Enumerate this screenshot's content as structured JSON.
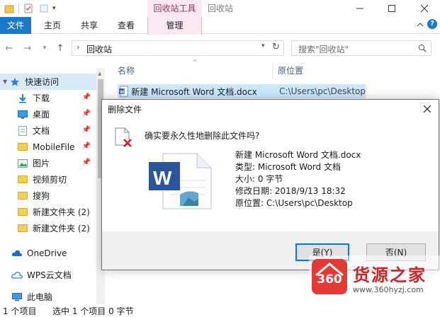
{
  "window": {
    "context_tab": "回收站工具",
    "title": "回收站"
  },
  "ribbon": {
    "tabs": [
      {
        "label": "文件"
      },
      {
        "label": "主页"
      },
      {
        "label": "共享"
      },
      {
        "label": "查看"
      },
      {
        "label": "管理"
      }
    ]
  },
  "address": {
    "path": "回收站",
    "search_placeholder": "搜索\"回收站\""
  },
  "nav": {
    "items": [
      {
        "label": "快速访问",
        "icon": "star-icon"
      },
      {
        "label": "下载",
        "icon": "download-icon"
      },
      {
        "label": "桌面",
        "icon": "desktop-icon"
      },
      {
        "label": "文档",
        "icon": "document-icon"
      },
      {
        "label": "MobileFile",
        "icon": "folder-icon"
      },
      {
        "label": "图片",
        "icon": "picture-icon"
      },
      {
        "label": "视频剪切",
        "icon": "folder-icon"
      },
      {
        "label": "搜狗",
        "icon": "folder-icon"
      },
      {
        "label": "新建文件夹 (2)",
        "icon": "folder-icon"
      },
      {
        "label": "新建文件夹 (2)",
        "icon": "folder-icon"
      },
      {
        "label": "OneDrive",
        "icon": "cloud-icon"
      },
      {
        "label": "WPS云文档",
        "icon": "wps-cloud-icon"
      },
      {
        "label": "此电脑",
        "icon": "computer-icon"
      }
    ]
  },
  "list": {
    "columns": [
      "名称",
      "原位置"
    ],
    "rows": [
      {
        "name": "新建 Microsoft Word 文档.docx",
        "location": "C:\\Users\\pc\\Desktop"
      }
    ]
  },
  "status": {
    "count": "1 个项目",
    "selected": "选中 1 个项目  0 字节"
  },
  "dialog": {
    "title": "删除文件",
    "question": "确实要永久性地删除此文件吗?",
    "file_name": "新建 Microsoft Word 文档.docx",
    "type": "类型: Microsoft Word 文档",
    "size": "大小: 0 字节",
    "modified": "修改日期: 2018/9/13 18:32",
    "origin": "原位置: C:\\Users\\pc\\Desktop",
    "yes_label": "是(Y)",
    "no_label": "否(N)"
  },
  "watermark": {
    "badge": "360",
    "text": "货源之家",
    "url": "www.360hyzj.com"
  },
  "colors": {
    "accent": "#1979ca",
    "context_tab_bg": "#fbe8f1",
    "selection": "#cce8ff",
    "watermark_red": "#e53935"
  }
}
